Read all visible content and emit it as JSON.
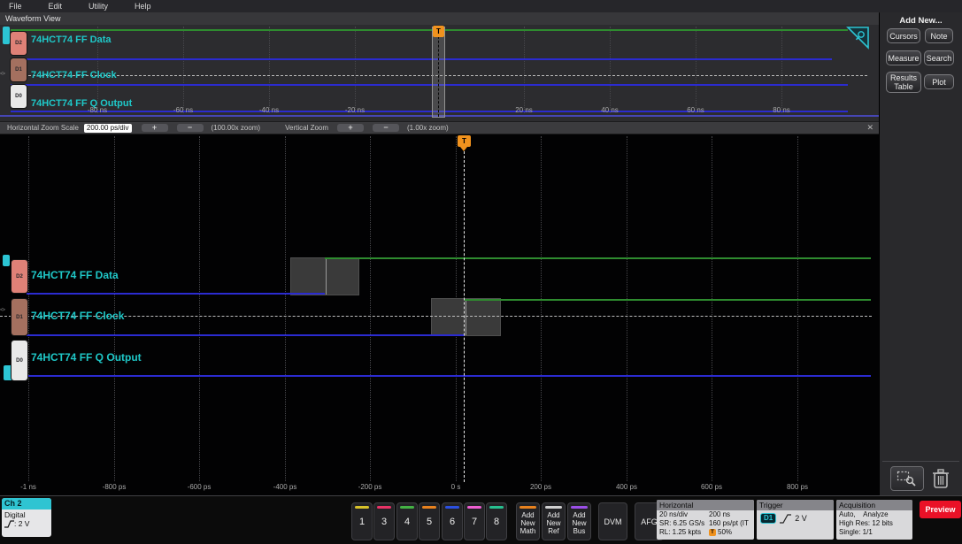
{
  "menu": {
    "items": [
      "File",
      "Edit",
      "Utility",
      "Help"
    ]
  },
  "view_title": "Waveform View",
  "channels": [
    {
      "id": "D2",
      "label": "74HCT74 FF Data",
      "color": "#df8177"
    },
    {
      "id": "D1",
      "label": "74HCT74 FF Clock",
      "color": "#a4705f"
    },
    {
      "id": "D0",
      "label": "74HCT74 FF Q Output",
      "color": "#e9e9e9"
    }
  ],
  "overview": {
    "axis_ticks": [
      "-80 ns",
      "-60 ns",
      "-40 ns",
      "-20 ns",
      "20 ns",
      "40 ns",
      "60 ns",
      "80 ns"
    ],
    "trigger_source_glyph": "<>"
  },
  "zoom_toolbar": {
    "label": "Horizontal Zoom Scale",
    "scale_value": "200.00 ps/div",
    "plus": "+",
    "minus": "−",
    "h_zoom_readout": "(100.00x zoom)",
    "vertical_label": "Vertical Zoom",
    "v_zoom_readout": "(1.00x zoom)",
    "close_glyph": "✕"
  },
  "main_view": {
    "axis_ticks": [
      "-1 ns",
      "-800 ps",
      "-600 ps",
      "-400 ps",
      "-200 ps",
      "0 s",
      "200 ps",
      "400 ps",
      "600 ps",
      "800 ps"
    ],
    "trigger_flag": "T"
  },
  "waveform_data": {
    "high_color": "#2e8b2f",
    "low_color": "#2b2bd0",
    "trigger_color": "#f0921e",
    "signals": [
      {
        "name": "74HCT74 FF Data",
        "state": "low, rises to high at about -320 ps"
      },
      {
        "name": "74HCT74 FF Clock",
        "state": "low, rises to high at 0 s (trigger point)"
      },
      {
        "name": "74HCT74 FF Q Output",
        "state": "low for entire window"
      }
    ]
  },
  "sidebar": {
    "title": "Add New...",
    "buttons": [
      "Cursors",
      "Note",
      "Measure",
      "Search",
      "Results Table",
      "Plot"
    ],
    "splitter_glyph": "⋮"
  },
  "bottom": {
    "channel_badge": {
      "name": "Ch 2",
      "mode": "Digital",
      "threshold": ": 2 V",
      "color": "#2fc4d2"
    },
    "digital_channels": [
      {
        "label": "1",
        "color": "#d8c22a"
      },
      {
        "label": "3",
        "color": "#e83366"
      },
      {
        "label": "4",
        "color": "#44b244"
      },
      {
        "label": "5",
        "color": "#e8821e"
      },
      {
        "label": "6",
        "color": "#2b50e0"
      },
      {
        "label": "7",
        "color": "#ef5fd2"
      },
      {
        "label": "8",
        "color": "#27c08f"
      }
    ],
    "add_buttons": [
      {
        "line1": "Add",
        "line2": "New",
        "line3": "Math",
        "color": "#e8821e"
      },
      {
        "line1": "Add",
        "line2": "New",
        "line3": "Ref",
        "color": "#d0d0d0"
      },
      {
        "line1": "Add",
        "line2": "New",
        "line3": "Bus",
        "color": "#9b4fe8"
      }
    ],
    "dvm_label": "DVM",
    "afg_label": "AFG",
    "horizontal": {
      "title": "Horizontal",
      "rows": [
        {
          "left": "20 ns/div",
          "right": "200 ns"
        },
        {
          "left": "SR: 6.25 GS/s",
          "right": "160 ps/pt (IT"
        },
        {
          "left": "RL: 1.25 kpts",
          "right": "50%"
        }
      ]
    },
    "trigger": {
      "title": "Trigger",
      "source": "D1",
      "level": "2 V"
    },
    "acquisition": {
      "title": "Acquisition",
      "rows": [
        "Auto,    Analyze",
        "High Res: 12 bits",
        "Single: 1/1"
      ]
    },
    "preview_label": "Preview",
    "preview_color": "#ea1127"
  }
}
